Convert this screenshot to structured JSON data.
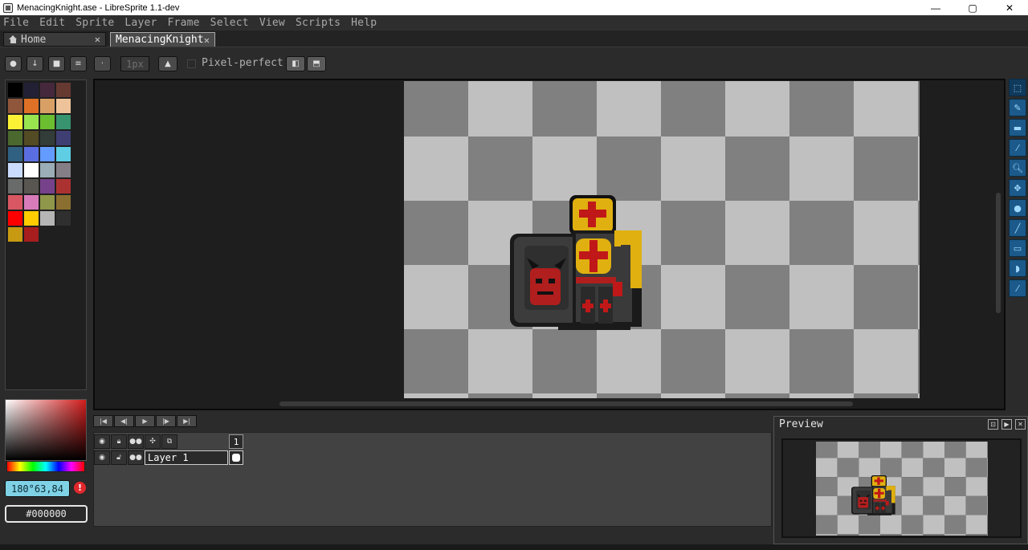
{
  "window": {
    "title": "MenacingKnight.ase - LibreSprite 1.1-dev"
  },
  "window_controls": {
    "minimize": "—",
    "maximize": "▢",
    "close": "✕"
  },
  "menu": [
    "File",
    "Edit",
    "Sprite",
    "Layer",
    "Frame",
    "Select",
    "View",
    "Scripts",
    "Help"
  ],
  "tabs": [
    {
      "label": "Home",
      "close": "✕"
    },
    {
      "label": "MenacingKnight",
      "close": "✕"
    }
  ],
  "contextbar": {
    "brush_size": "1px",
    "pixel_perfect_label": "Pixel-perfect",
    "pixel_perfect_checked": false
  },
  "palette": {
    "colors": [
      "#000000",
      "#222034",
      "#45283c",
      "#663931",
      "#8f563b",
      "#df7126",
      "#d9a066",
      "#eec39a",
      "#fbf236",
      "#99e550",
      "#6abe30",
      "#37946e",
      "#4b692f",
      "#524b24",
      "#323c39",
      "#3f3f74",
      "#306082",
      "#5b6ee1",
      "#639bff",
      "#5fcde4",
      "#cbdbfc",
      "#ffffff",
      "#9badb7",
      "#847e87",
      "#696a6a",
      "#595652",
      "#76428a",
      "#ac3232",
      "#d95763",
      "#d77bba",
      "#8f974a",
      "#8a6f30",
      "#ff0000",
      "#ffcc00",
      "#b5b5b5",
      "#2f2f2f",
      "#c89a12",
      "#a81d1d"
    ]
  },
  "color": {
    "hsv": "180°63,84",
    "hex": "#000000"
  },
  "tools": [
    "marquee-tool",
    "pencil-tool",
    "eraser-tool",
    "eyedropper-tool",
    "zoom-tool",
    "move-tool",
    "paint-bucket-tool",
    "line-tool",
    "rectangle-tool",
    "lasso-tool",
    "blur-tool"
  ],
  "timeline": {
    "frame_number": "1",
    "layers": [
      {
        "name": "Layer 1"
      }
    ]
  },
  "preview": {
    "title": "Preview"
  },
  "colors": {
    "checker_dark": "#808080",
    "checker_light": "#c0c0c0",
    "tool_blue": "#1b5a8a",
    "hsv_field": "#7fd2e6"
  }
}
